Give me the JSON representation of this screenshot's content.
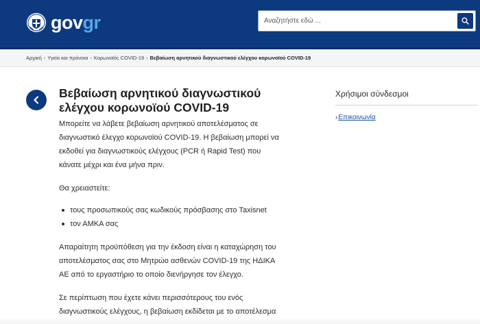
{
  "header": {
    "logo_gov": "gov",
    "logo_gr": "gr",
    "search_placeholder": "Αναζητήστε εδώ ...",
    "colors": {
      "primary": "#0d3a7e",
      "accent": "#55a6e6"
    },
    "icons": {
      "emblem": "greek-emblem-icon",
      "search": "search-icon"
    }
  },
  "breadcrumb": {
    "items": [
      "Αρχική",
      "Υγεία και πρόνοια",
      "Κορωνοϊός COVID-19"
    ],
    "current": "Βεβαίωση αρνητικού διαγνωστικού ελέγχου κορωνοϊού COVID-19",
    "separator": "›"
  },
  "main": {
    "back_icon": "chevron-left-icon",
    "title": "Βεβαίωση αρνητικού διαγνωστικού ελέγχου κορωνοϊού COVID-19",
    "intro": "Μπορείτε να λάβετε βεβαίωση αρνητικού αποτελέσματος σε διαγνωστικό έλεγχο κορωνοϊού COVID-19. Η βεβαίωση μπορεί να εκδοθεί για διαγνωστικούς ελέγχους (PCR ή Rapid Test) που κάνατε μέχρι και ένα μήνα πριν.",
    "need_label": "Θα χρειαστείτε:",
    "requirements": [
      "τους προσωπικούς σας κωδικούς πρόσβασης στο Taxisnet",
      "τον ΑΜΚΑ σας"
    ],
    "prerequisite": "Απαραίτητη προϋπόθεση για την έκδοση είναι η καταχώρηση του αποτελέσματος σας στο Μητρώο ασθενών COVID-19 της ΗΔΙΚΑ ΑΕ από το εργαστήριο το οποίο διενήργησε τον έλεγχο.",
    "multiple_tests": "Σε περίπτωση που έχετε κάνει περισσότερους του ενός διαγνωστικούς ελέγχους, η βεβαίωση εκδίδεται με το αποτέλεσμα του πιο πρόσφατου."
  },
  "sidebar": {
    "title": "Χρήσιμοι σύνδεσμοι",
    "links": [
      {
        "chevron": "›",
        "label": "Επικοινωνία"
      }
    ]
  }
}
